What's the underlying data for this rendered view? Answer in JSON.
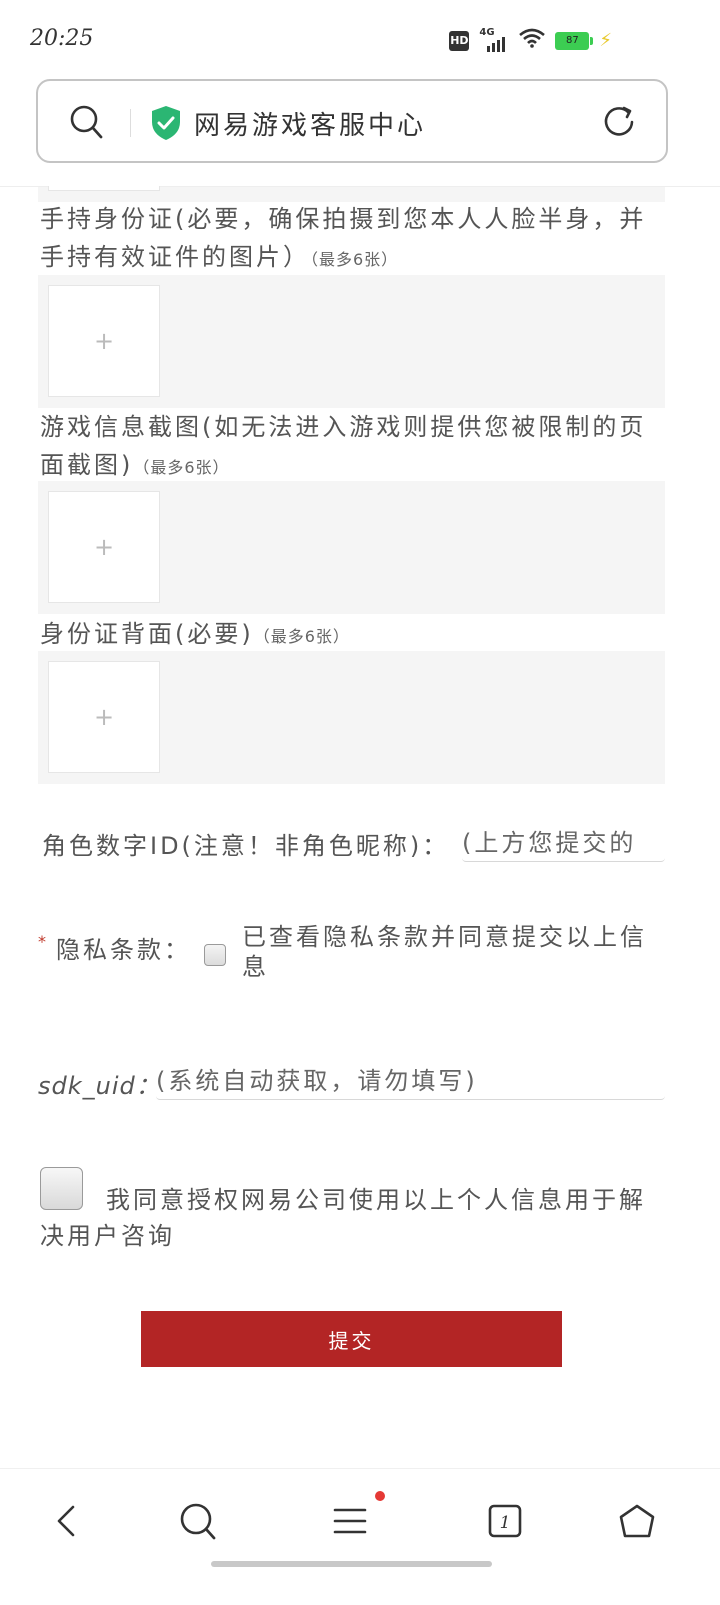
{
  "status_bar": {
    "time": "20:25",
    "hd": "HD",
    "network": "4G",
    "battery": "87"
  },
  "address_bar": {
    "title": "网易游戏客服中心"
  },
  "form": {
    "handheld_id_label": "手持身份证(必要，确保拍摄到您本人人脸半身，并手持有效证件的图片）",
    "handheld_id_hint": "（最多6张）",
    "game_screenshot_label": "游戏信息截图(如无法进入游戏则提供您被限制的页面截图)",
    "game_screenshot_hint": "（最多6张）",
    "id_back_label": "身份证背面(必要)",
    "id_back_hint": "（最多6张）",
    "upload_plus": "+",
    "role_id_label": "角色数字ID(注意！非角色昵称)：",
    "role_id_placeholder": "(上方您提交的",
    "required_mark": "*",
    "privacy_label": "隐私条款：",
    "privacy_text": "已查看隐私条款并同意提交以上信息",
    "sdk_uid_label": "sdk_uid：",
    "sdk_uid_placeholder": "(系统自动获取，请勿填写)",
    "consent_text": "我同意授权网易公司使用以上个人信息用于解决用户咨询",
    "submit_label": "提交"
  },
  "bottom_nav": {
    "tab_count": "1"
  }
}
